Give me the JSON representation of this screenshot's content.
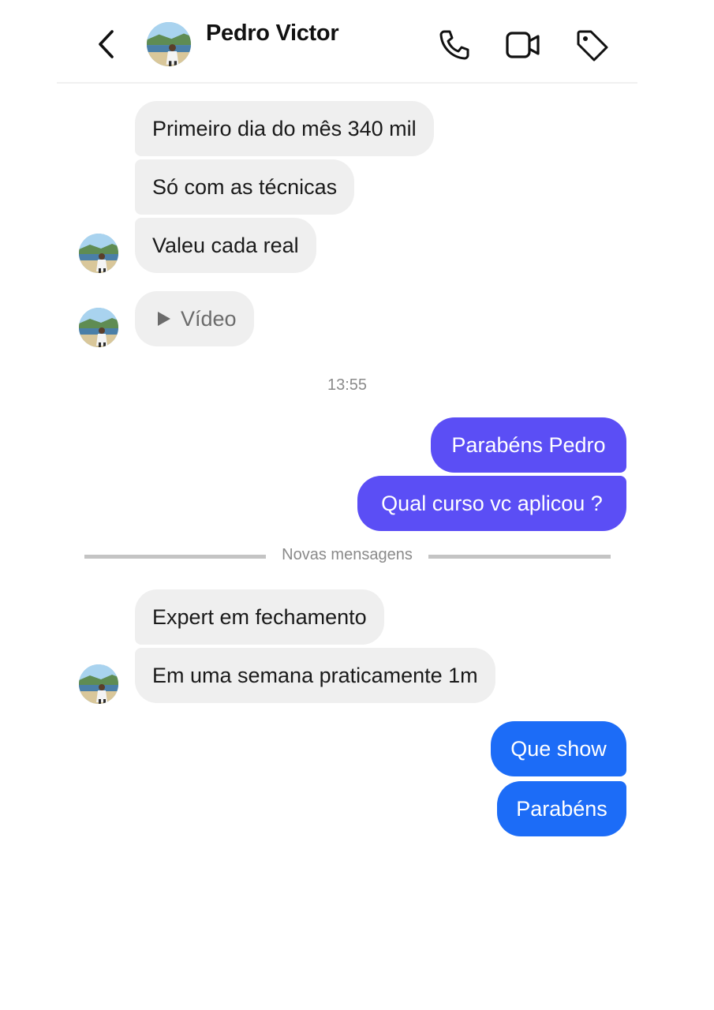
{
  "header": {
    "contact_name": "Pedro Victor",
    "contact_status": "",
    "back_icon": "chevron-left-icon",
    "actions": [
      {
        "name": "call",
        "icon": "phone-icon"
      },
      {
        "name": "video",
        "icon": "video-camera-icon"
      },
      {
        "name": "tag",
        "icon": "tag-icon"
      }
    ]
  },
  "messages_group1": [
    {
      "text": "Primeiro dia do mês 340 mil"
    },
    {
      "text": "Só com as técnicas"
    },
    {
      "text": "Valeu cada real"
    },
    {
      "text": "Vídeo",
      "icon": "play-icon"
    }
  ],
  "timestamp": "13:55",
  "sent_group1": [
    {
      "text": "Parabéns Pedro"
    },
    {
      "text": "Qual curso vc aplicou ?"
    }
  ],
  "divider": {
    "label": "Novas mensagens"
  },
  "messages_group2": [
    {
      "text": "Expert em fechamento"
    },
    {
      "text": "Em uma semana praticamente 1m"
    }
  ],
  "sent_group2": [
    {
      "text": "Que show"
    },
    {
      "text": "Parabéns"
    }
  ],
  "colors": {
    "incoming_bubble": "#efefef",
    "sent_purple": "#5b4ef5",
    "sent_blue": "#1c6cf7",
    "meta_text": "#8a8a8a"
  }
}
